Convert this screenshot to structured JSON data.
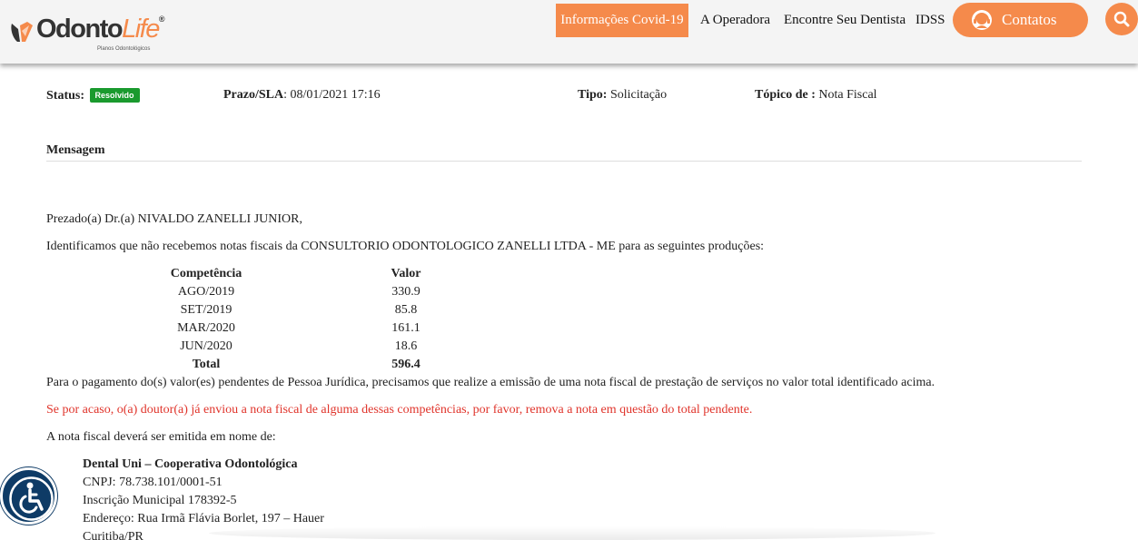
{
  "brand": {
    "name_main": "Odonto",
    "name_accent": "Life",
    "tagline": "Planos Odontológicos",
    "accent_color": "#f58a4b"
  },
  "nav": {
    "covid": "Informações Covid-19",
    "operadora": "A Operadora",
    "dentista": "Encontre Seu Dentista",
    "idss": "IDSS",
    "contatos": "Contatos",
    "search_icon": "search-icon"
  },
  "ticket": {
    "status_label": "Status:",
    "status_value": "Resolvido",
    "status_color": "#1a9a2e",
    "prazo_label": "Prazo/SLA",
    "prazo_value": ": 08/01/2021 17:16",
    "tipo_label": "Tipo:",
    "tipo_value": " Solicitação",
    "topico_label": "Tópico de :",
    "topico_value": " Nota Fiscal",
    "mensagem_label": "Mensagem"
  },
  "message": {
    "greeting": "Prezado(a) Dr.(a) NIVALDO ZANELLI JUNIOR,",
    "intro": "Identificamos que não recebemos notas fiscais da CONSULTORIO ODONTOLOGICO ZANELLI LTDA - ME para as seguintes produções:",
    "table": {
      "headers": [
        "Competência",
        "Valor"
      ],
      "rows": [
        [
          "AGO/2019",
          "330.9"
        ],
        [
          "SET/2019",
          "85.8"
        ],
        [
          "MAR/2020",
          "161.1"
        ],
        [
          "JUN/2020",
          "18.6"
        ]
      ],
      "total_label": "Total",
      "total_value": "596.4"
    },
    "payment": "Para o pagamento do(s) valor(es) pendentes de Pessoa Jurídica, precisamos que realize a emissão de uma nota fiscal de prestação de serviços no valor total identificado acima.",
    "warning": "Se por acaso, o(a) doutor(a) já enviou a nota fiscal de alguma dessas competências, por favor, remova a nota em questão do total pendente.",
    "issue_to": "A nota fiscal deverá ser emitida em nome de:",
    "company": {
      "name": "Dental Uni – Cooperativa Odontológica",
      "cnpj": "CNPJ: 78.738.101/0001-51",
      "inscricao": "Inscrição Municipal 178392-5",
      "endereco": "Endereço: Rua Irmã Flávia Borlet, 197 – Hauer",
      "cidade": "Curitiba/PR"
    }
  },
  "accessibility_icon": "accessibility-icon"
}
